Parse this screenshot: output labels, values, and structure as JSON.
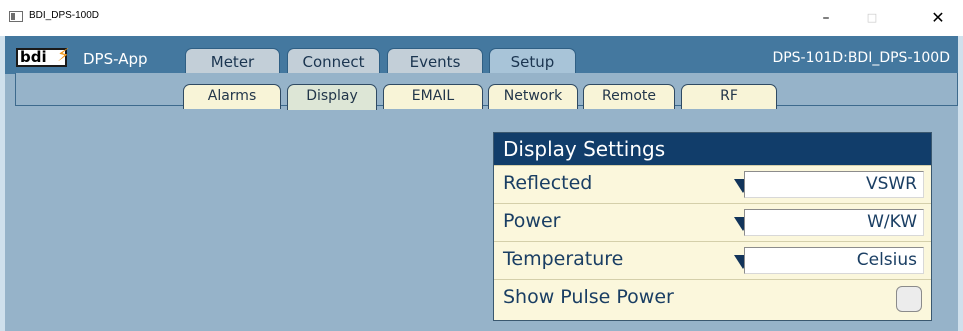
{
  "window": {
    "title": "BDI_DPS-100D",
    "minimize": "–",
    "maximize": "□",
    "close": "✕"
  },
  "header": {
    "logo": "bdi",
    "app_name": "DPS-App",
    "device_label": "DPS-101D:BDI_DPS-100D"
  },
  "main_tabs": [
    {
      "label": "Meter"
    },
    {
      "label": "Connect"
    },
    {
      "label": "Events"
    },
    {
      "label": "Setup"
    }
  ],
  "main_tab_active": "Setup",
  "sub_tabs": [
    {
      "label": "Alarms"
    },
    {
      "label": "Display"
    },
    {
      "label": "EMAIL"
    },
    {
      "label": "Network"
    },
    {
      "label": "Remote"
    },
    {
      "label": "RF"
    }
  ],
  "sub_tab_active": "Display",
  "panel": {
    "title": "Display Settings",
    "rows": [
      {
        "label": "Reflected",
        "value": "VSWR"
      },
      {
        "label": "Power",
        "value": "W/KW"
      },
      {
        "label": "Temperature",
        "value": "Celsius"
      }
    ],
    "checkbox": {
      "label": "Show Pulse Power",
      "checked": false
    }
  },
  "colors": {
    "header_bg": "#44789f",
    "app_bg": "#96b3c9",
    "panel_head": "#113d6a",
    "panel_bg": "#fbf7dc",
    "logo_bolt": "#f29a1e"
  }
}
